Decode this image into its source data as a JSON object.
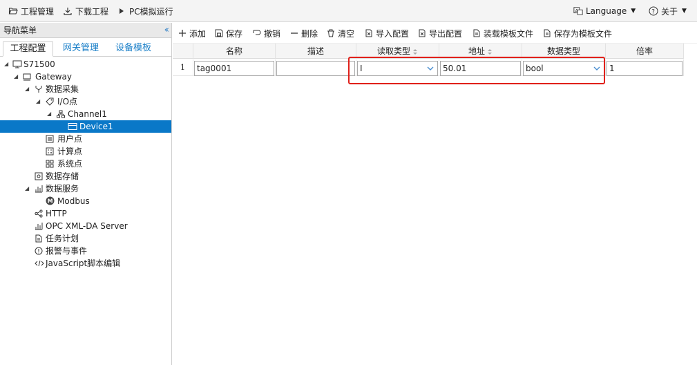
{
  "topbar": {
    "project": "工程管理",
    "download": "下载工程",
    "simulate": "PC模拟运行",
    "language": "Language",
    "about": "关于"
  },
  "nav": {
    "title": "导航菜单",
    "tabs": [
      "工程配置",
      "网关管理",
      "设备模板"
    ],
    "tree": {
      "root": "S71500",
      "gateway": "Gateway",
      "data_collection": "数据采集",
      "io_points": "I/O点",
      "channel": "Channel1",
      "device": "Device1",
      "user_points": "用户点",
      "calc_points": "计算点",
      "system_points": "系统点",
      "data_storage": "数据存储",
      "data_service": "数据服务",
      "modbus": "Modbus",
      "http": "HTTP",
      "opc": "OPC XML-DA Server",
      "task": "任务计划",
      "alarm": "报警与事件",
      "script": "JavaScript脚本编辑"
    }
  },
  "toolbar": {
    "add": "添加",
    "save": "保存",
    "undo": "撤销",
    "delete": "删除",
    "clear": "清空",
    "import": "导入配置",
    "export": "导出配置",
    "load_template": "装载模板文件",
    "save_template": "保存为模板文件"
  },
  "table": {
    "headers": [
      "名称",
      "描述",
      "读取类型",
      "地址",
      "数据类型",
      "倍率"
    ],
    "rows": [
      {
        "index": "1",
        "name": "tag0001",
        "desc": "",
        "read_type": "I",
        "address": "50.01",
        "data_type": "bool",
        "ratio": "1"
      }
    ]
  },
  "colors": {
    "accent": "#0a78c8",
    "tab_link": "#1a7fc8",
    "highlight": "#e0201a"
  }
}
